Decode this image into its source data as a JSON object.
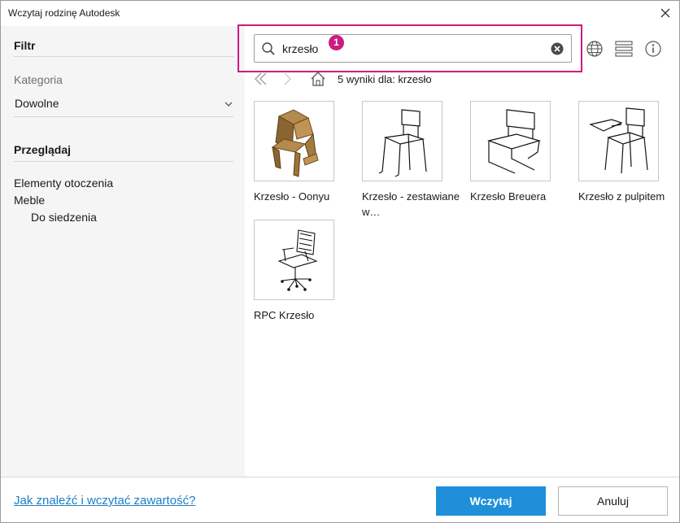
{
  "window": {
    "title": "Wczytaj rodzinę Autodesk"
  },
  "sidebar": {
    "filter_heading": "Filtr",
    "category_label": "Kategoria",
    "category_value": "Dowolne",
    "browse_heading": "Przeglądaj",
    "browse_items": [
      "Elementy otoczenia",
      "Meble",
      "Do siedzenia"
    ]
  },
  "search": {
    "value": "krzesło",
    "badge": "1"
  },
  "results_text": "5 wyniki  dla: krzesło",
  "items": [
    {
      "label": "Krzesło - Oonyu"
    },
    {
      "label": "Krzesło - zestawiane w…"
    },
    {
      "label": "Krzesło Breuera"
    },
    {
      "label": "Krzesło z pulpitem"
    },
    {
      "label": "RPC Krzesło"
    }
  ],
  "footer": {
    "help_link": "Jak znaleźć i wczytać zawartość?",
    "load_button": "Wczytaj",
    "cancel_button": "Anuluj"
  },
  "colors": {
    "accent": "#1f8fda",
    "highlight": "#cc1b7f",
    "link": "#1b7fc4",
    "sidebar_bg": "#f5f5f5"
  }
}
